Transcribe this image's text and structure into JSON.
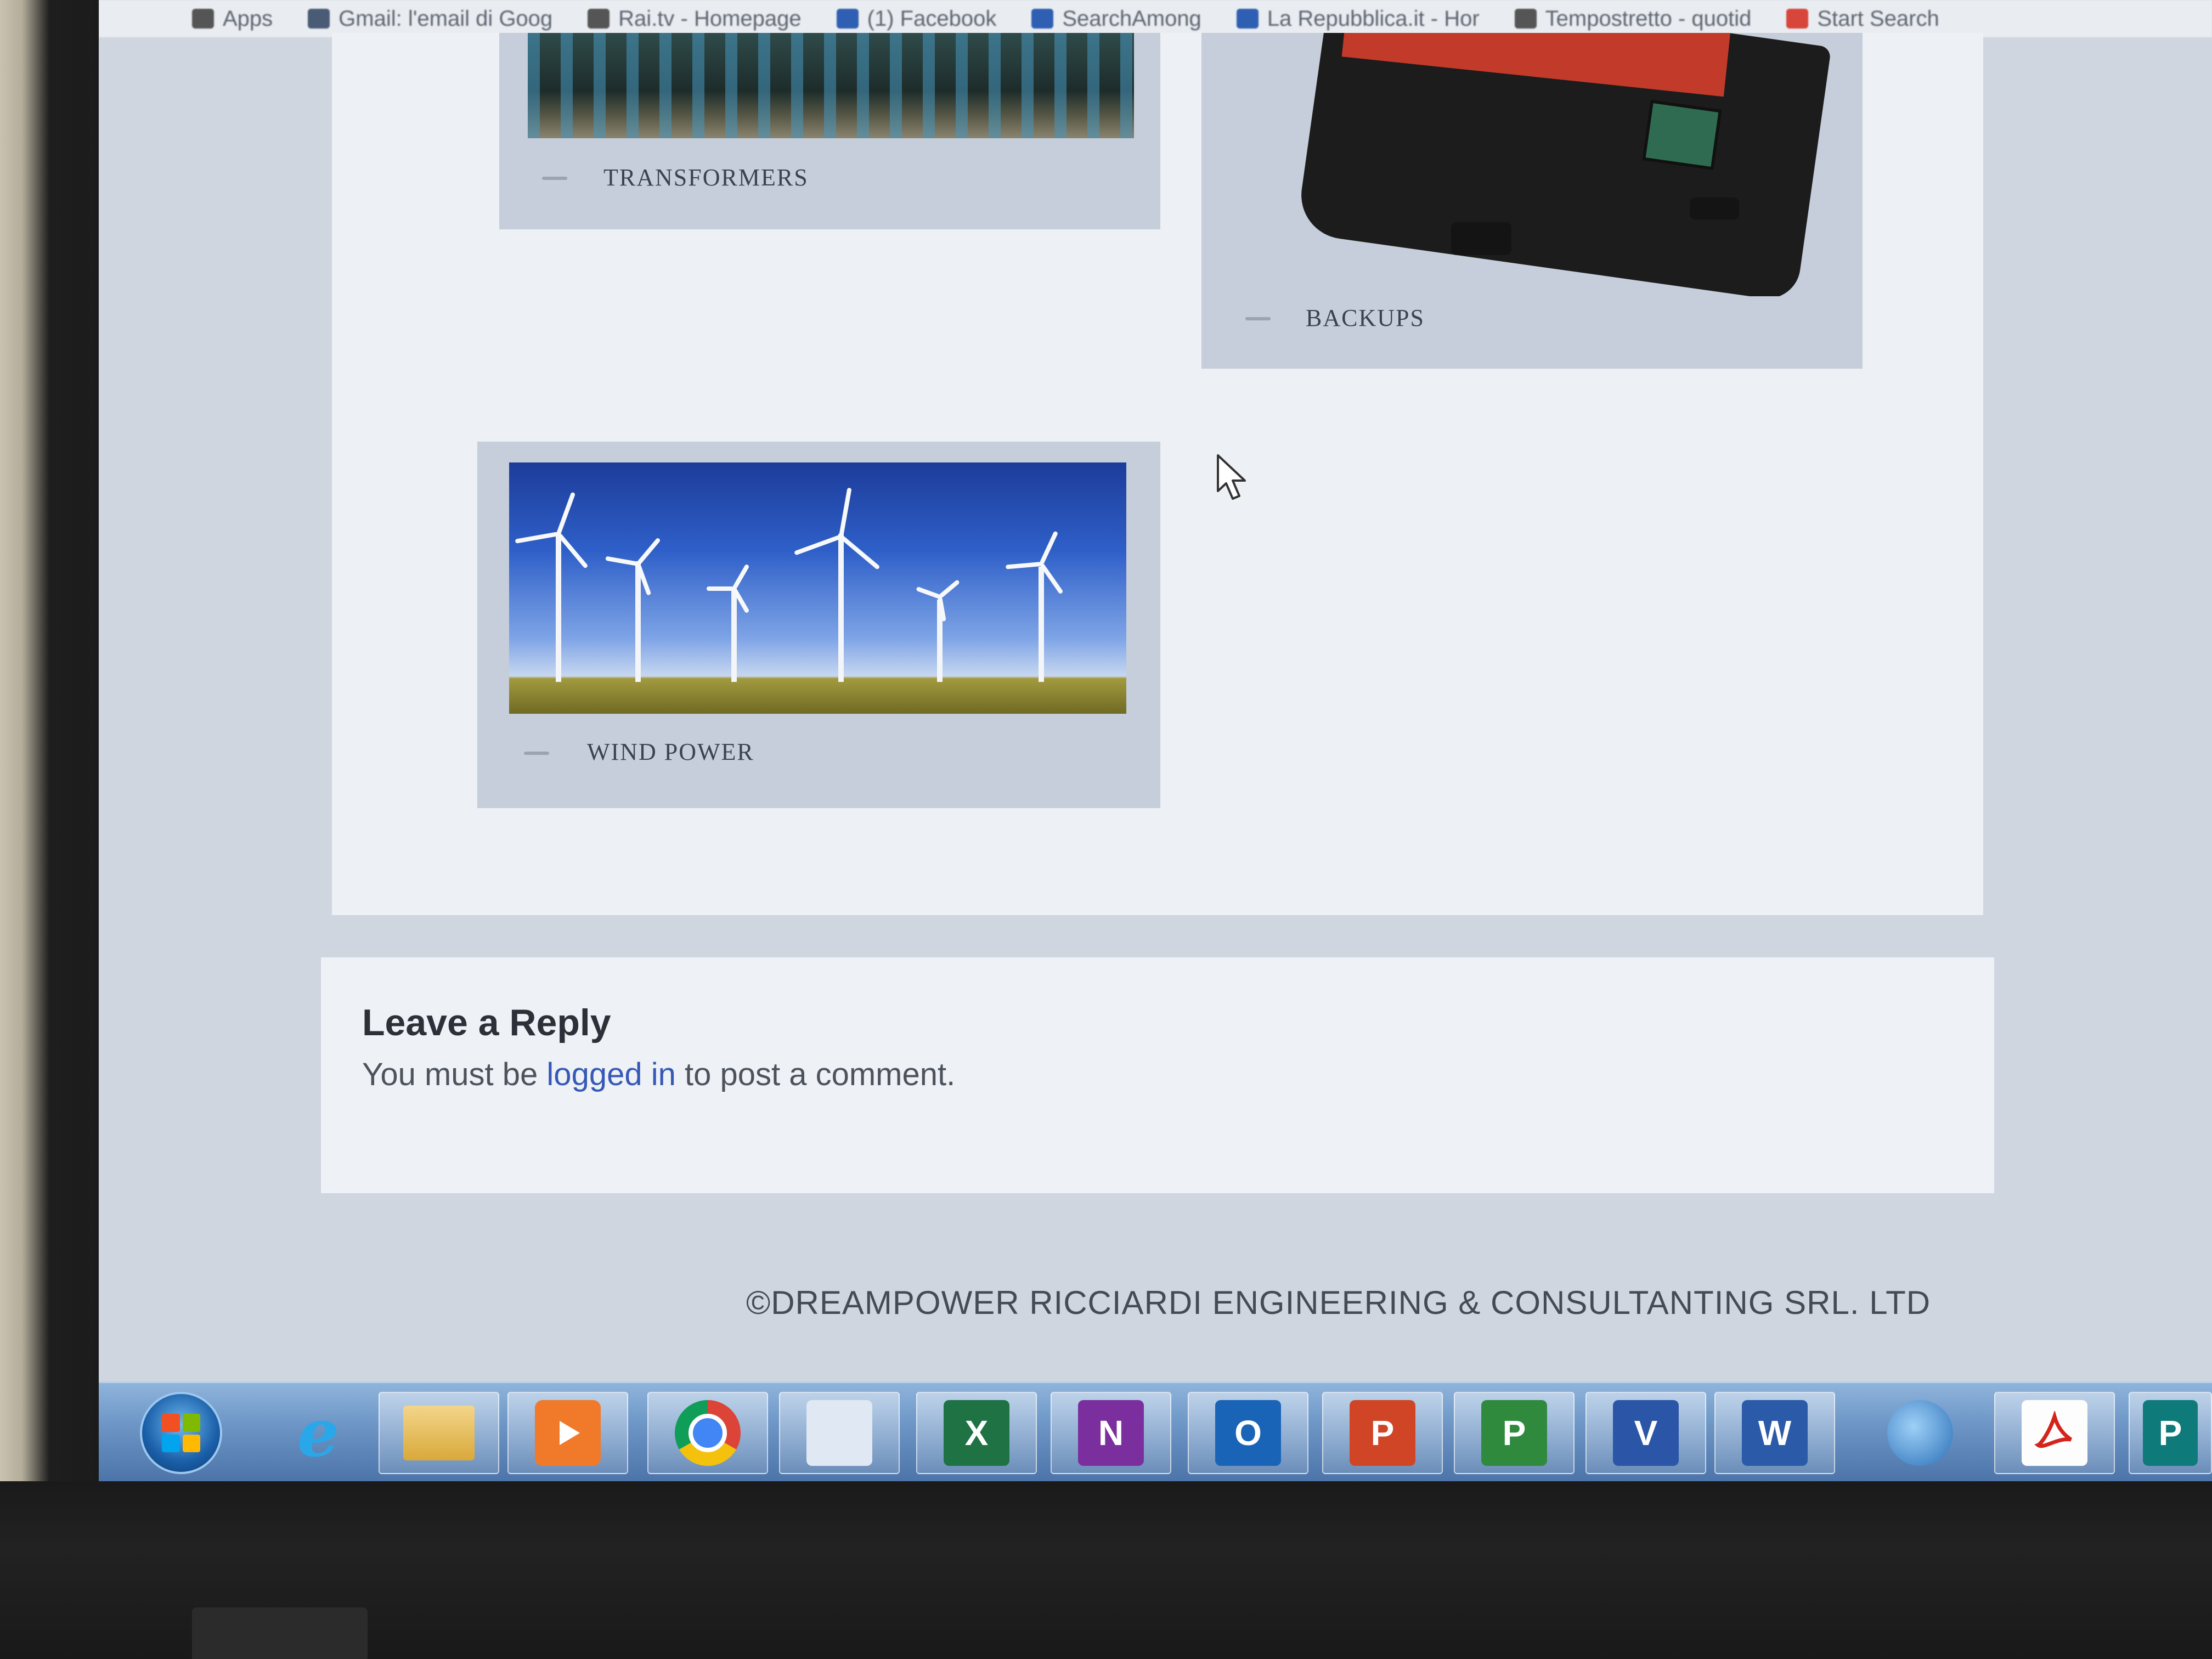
{
  "bookmarks": [
    {
      "label": "Apps",
      "icon": "apps-grid-icon"
    },
    {
      "label": "Gmail: l'email di Goog",
      "icon": "google-icon"
    },
    {
      "label": "Rai.tv - Homepage",
      "icon": "raitv-icon"
    },
    {
      "label": "(1) Facebook",
      "icon": "facebook-icon"
    },
    {
      "label": "SearchAmong",
      "icon": "search-icon"
    },
    {
      "label": "La Repubblica.it - Hor",
      "icon": "repubblica-icon"
    },
    {
      "label": "Tempostretto - quotid",
      "icon": "tempostretto-icon"
    },
    {
      "label": "Start Search",
      "icon": "start-search-icon"
    }
  ],
  "gallery": {
    "items": [
      {
        "label": "TRANSFORMERS",
        "image": "transformers-photo"
      },
      {
        "label": "BACKUPS",
        "image": "ups-backup-device-photo"
      },
      {
        "label": "WIND POWER",
        "image": "wind-turbines-photo"
      }
    ]
  },
  "reply": {
    "title": "Leave a Reply",
    "text_before": "You must be ",
    "link": "logged in",
    "text_after": " to post a comment."
  },
  "footer": {
    "copyright": "©DREAMPOWER RICCIARDI ENGINEERING & CONSULTANTING SRL. LTD"
  },
  "taskbar": {
    "apps": [
      {
        "name": "Start",
        "icon": "windows-start-icon"
      },
      {
        "name": "Internet Explorer",
        "icon": "internet-explorer-icon",
        "glyph": "e"
      },
      {
        "name": "File Explorer",
        "icon": "file-explorer-icon"
      },
      {
        "name": "Media Player",
        "icon": "media-player-icon"
      },
      {
        "name": "Chrome",
        "icon": "chrome-icon"
      },
      {
        "name": "App",
        "icon": "app-icon"
      },
      {
        "name": "Excel",
        "icon": "excel-icon",
        "glyph": "X"
      },
      {
        "name": "OneNote",
        "icon": "onenote-icon",
        "glyph": "N"
      },
      {
        "name": "Outlook",
        "icon": "outlook-icon",
        "glyph": "O"
      },
      {
        "name": "PowerPoint",
        "icon": "powerpoint-icon",
        "glyph": "P"
      },
      {
        "name": "Project",
        "icon": "project-icon",
        "glyph": "P"
      },
      {
        "name": "Visio",
        "icon": "visio-icon",
        "glyph": "V"
      },
      {
        "name": "Word",
        "icon": "word-icon",
        "glyph": "W"
      },
      {
        "name": "Thunderbird",
        "icon": "thunderbird-icon"
      },
      {
        "name": "Acrobat",
        "icon": "acrobat-icon"
      },
      {
        "name": "Publisher",
        "icon": "publisher-icon",
        "glyph": "P"
      }
    ]
  },
  "colors": {
    "link": "#3559b7",
    "excel": "#1f7244",
    "onenote": "#7b2f9e",
    "outlook": "#1a64b8",
    "powerpoint": "#d04525",
    "project": "#2f8a3e",
    "visio": "#2b56a8",
    "word": "#2a5aa8",
    "publisher": "#0f7a7a"
  }
}
